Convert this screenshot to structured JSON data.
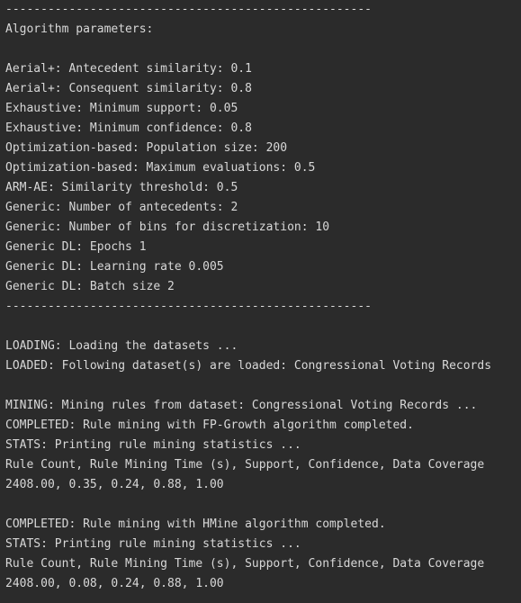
{
  "console": {
    "lines": [
      "----------------------------------------------------",
      "Algorithm parameters:",
      "",
      "Aerial+: Antecedent similarity: 0.1",
      "Aerial+: Consequent similarity: 0.8",
      "Exhaustive: Minimum support: 0.05",
      "Exhaustive: Minimum confidence: 0.8",
      "Optimization-based: Population size: 200",
      "Optimization-based: Maximum evaluations: 0.5",
      "ARM-AE: Similarity threshold: 0.5",
      "Generic: Number of antecedents: 2",
      "Generic: Number of bins for discretization: 10",
      "Generic DL: Epochs 1",
      "Generic DL: Learning rate 0.005",
      "Generic DL: Batch size 2",
      "----------------------------------------------------",
      "",
      "LOADING: Loading the datasets ...",
      "LOADED: Following dataset(s) are loaded: Congressional Voting Records",
      "",
      "MINING: Mining rules from dataset: Congressional Voting Records ...",
      "COMPLETED: Rule mining with FP-Growth algorithm completed.",
      "STATS: Printing rule mining statistics ...",
      "Rule Count, Rule Mining Time (s), Support, Confidence, Data Coverage",
      "2408.00, 0.35, 0.24, 0.88, 1.00",
      "",
      "COMPLETED: Rule mining with HMine algorithm completed.",
      "STATS: Printing rule mining statistics ...",
      "Rule Count, Rule Mining Time (s), Support, Confidence, Data Coverage",
      "2408.00, 0.08, 0.24, 0.88, 1.00"
    ]
  }
}
